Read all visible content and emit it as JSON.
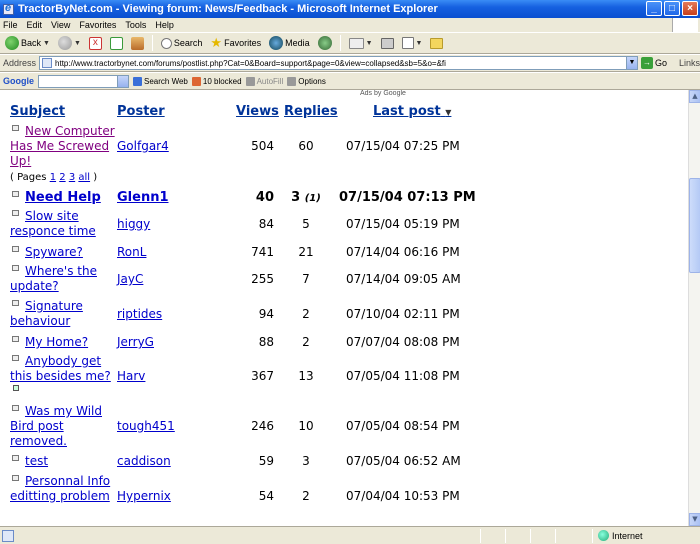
{
  "window": {
    "title": "TractorByNet.com - Viewing forum: News/Feedback - Microsoft Internet Explorer"
  },
  "menu": [
    "File",
    "Edit",
    "View",
    "Favorites",
    "Tools",
    "Help"
  ],
  "toolbar": {
    "back": "Back",
    "search": "Search",
    "favorites": "Favorites",
    "media": "Media"
  },
  "address": {
    "label": "Address",
    "url": "http://www.tractorbynet.com/forums/postlist.php?Cat=0&Board=support&page=0&view=collapsed&sb=5&o=&fi",
    "go": "Go",
    "links": "Links"
  },
  "googlebar": {
    "logo": "Google",
    "search_web": "Search Web",
    "blocked": "10 blocked",
    "autofill": "AutoFill",
    "options": "Options"
  },
  "ads_label": "Ads by Google",
  "forum": {
    "headers": {
      "subject": "Subject",
      "poster": "Poster",
      "views": "Views",
      "replies": "Replies",
      "last_post": "Last post"
    },
    "pages_prefix": "( Pages",
    "pages": [
      "1",
      "2",
      "3",
      "all"
    ],
    "pages_suffix": ")",
    "rows": [
      {
        "subject": "New Computer Has Me Screwed Up!",
        "poster": "Golfgar4",
        "views": "504",
        "replies": "60",
        "last_post": "07/15/04 07:25 PM"
      },
      {
        "subject": "Need Help",
        "poster": "Glenn1",
        "views": "40",
        "replies": "3",
        "replies_new": "(1)",
        "last_post": "07/15/04 07:13 PM"
      },
      {
        "subject": "Slow site responce time",
        "poster": "higgy",
        "views": "84",
        "replies": "5",
        "last_post": "07/15/04 05:19 PM"
      },
      {
        "subject": "Spyware?",
        "poster": "RonL",
        "views": "741",
        "replies": "21",
        "last_post": "07/14/04 06:16 PM"
      },
      {
        "subject": "Where's the update?",
        "poster": "JayC",
        "views": "255",
        "replies": "7",
        "last_post": "07/14/04 09:05 AM"
      },
      {
        "subject": "Signature behaviour",
        "poster": "riptides",
        "views": "94",
        "replies": "2",
        "last_post": "07/10/04 02:11 PM"
      },
      {
        "subject": "My Home?",
        "poster": "JerryG",
        "views": "88",
        "replies": "2",
        "last_post": "07/07/04 08:08 PM"
      },
      {
        "subject": "Anybody get this besides me?",
        "poster": "Harv",
        "views": "367",
        "replies": "13",
        "last_post": "07/05/04 11:08 PM"
      },
      {
        "subject": "Was my Wild Bird post removed.",
        "poster": "tough451",
        "views": "246",
        "replies": "10",
        "last_post": "07/05/04 08:54 PM"
      },
      {
        "subject": "test",
        "poster": "caddison",
        "views": "59",
        "replies": "3",
        "last_post": "07/05/04 06:52 AM"
      },
      {
        "subject": "Personnal Info editting problem",
        "poster": "Hypernix",
        "views": "54",
        "replies": "2",
        "last_post": "07/04/04 10:53 PM"
      }
    ]
  },
  "status": {
    "zone": "Internet"
  }
}
